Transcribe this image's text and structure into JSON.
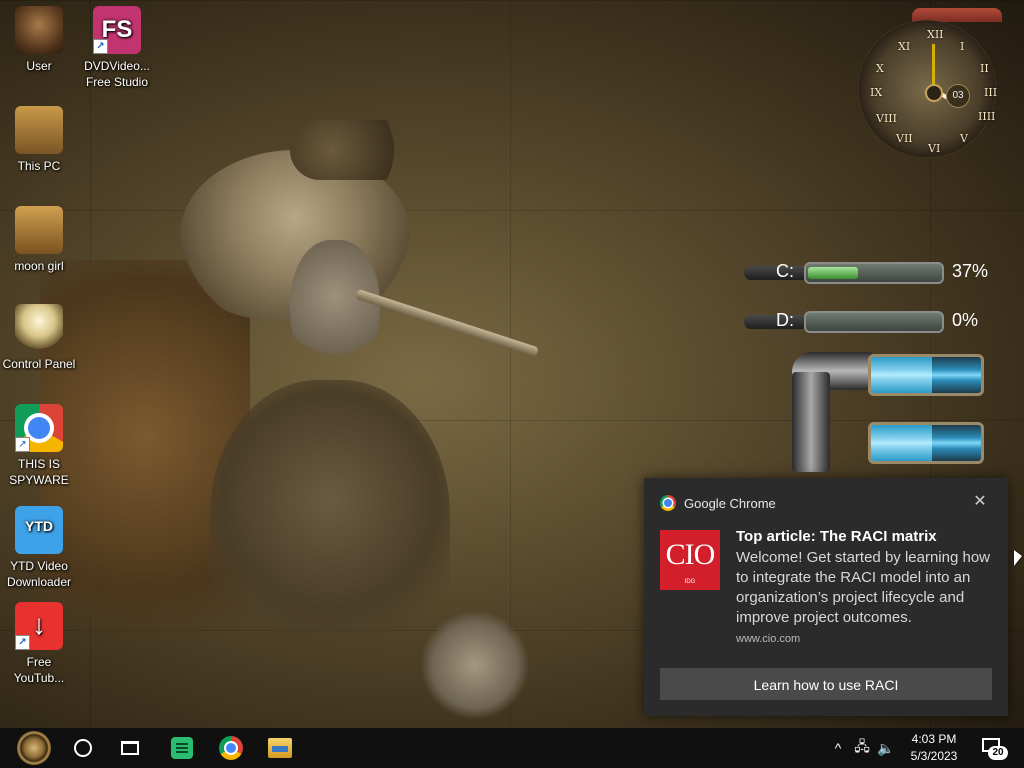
{
  "desktop_icons": [
    {
      "label": "User",
      "icon": "user-icon"
    },
    {
      "label": "DVDVideo...\nFree Studio",
      "icon": "fs-app-icon",
      "glyph": "FS"
    },
    {
      "label": "This PC",
      "icon": "computer-icon"
    },
    {
      "label": "moon girl",
      "icon": "folder-icon"
    },
    {
      "label": "Control Panel",
      "icon": "lightbulb-icon"
    },
    {
      "label": "THIS IS\nSPYWARE",
      "icon": "chrome-icon"
    },
    {
      "label": "YTD Video\nDownloader",
      "icon": "ytd-icon",
      "glyph": "YTD"
    },
    {
      "label": "Free\nYouTub...",
      "icon": "download-arrow-icon",
      "glyph": "↓"
    }
  ],
  "clock_widget": {
    "numerals": [
      "XII",
      "I",
      "II",
      "III",
      "IIII",
      "V",
      "VI",
      "VII",
      "VIII",
      "IX",
      "X",
      "XI"
    ],
    "date_day": "03"
  },
  "drives": [
    {
      "label": "C:",
      "percent_text": "37%",
      "fill_fraction": 0.37
    },
    {
      "label": "D:",
      "percent_text": "0%",
      "fill_fraction": 0.0
    }
  ],
  "gauges": [
    {
      "fill_fraction": 0.55
    },
    {
      "fill_fraction": 0.55
    }
  ],
  "notification": {
    "app_name": "Google Chrome",
    "close_glyph": "✕",
    "logo_text": "CIO",
    "logo_subtext": "IDG",
    "title": "Top article: The RACI matrix",
    "body": "Welcome! Get started by learning how to integrate the RACI model into an organization’s project lifecycle and improve project outcomes.",
    "site": "www.cio.com",
    "action_label": "Learn how to use RACI"
  },
  "taskbar": {
    "time": "4:03 PM",
    "date": "5/3/2023",
    "notification_count": "20",
    "tray_glyphs": {
      "chevron": "^",
      "network": "🖧",
      "volume": "🔈"
    }
  },
  "colors": {
    "toast_bg": "#2b2b2b",
    "taskbar_bg": "#101010",
    "cio_red": "#d21f2b",
    "drive_fill": "#3a8e2f"
  }
}
